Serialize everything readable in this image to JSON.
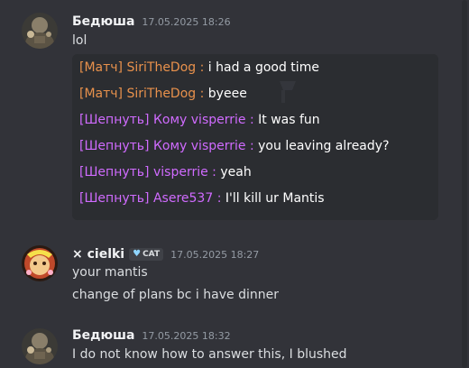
{
  "messages": [
    {
      "username": "Бедюша",
      "timestamp": "17.05.2025 18:26",
      "lines": [
        "lol"
      ],
      "embed_lines": [
        {
          "tag": "[Матч]",
          "name": "SiriTheDog",
          "sep": ":",
          "text": "i had a good time",
          "kind": "match"
        },
        {
          "tag": "[Матч]",
          "name": "SiriTheDog",
          "sep": ":",
          "text": "byeee",
          "kind": "match"
        },
        {
          "tag": "[Шепнуть]",
          "name": "Кому visperrie",
          "sep": ":",
          "text": "It was fun",
          "kind": "whisper"
        },
        {
          "tag": "[Шепнуть]",
          "name": "Кому visperrie",
          "sep": ":",
          "text": "you leaving already?",
          "kind": "whisper"
        },
        {
          "tag": "[Шепнуть]",
          "name": "visperrie",
          "sep": ":",
          "text": "yeah",
          "kind": "whisper"
        },
        {
          "tag": "[Шепнуть]",
          "name": "Asere537",
          "sep": ":",
          "text": "I'll kill ur Mantis",
          "kind": "whisper"
        }
      ]
    },
    {
      "username": "× cielki",
      "badge": "CAT",
      "badge_icon": "heart-icon",
      "timestamp": "17.05.2025 18:27",
      "lines": [
        "your mantis",
        "change of plans bc i have dinner"
      ]
    },
    {
      "username": "Бедюша",
      "timestamp": "17.05.2025 18:32",
      "lines": [
        "I do not know how to answer this, I blushed"
      ]
    }
  ],
  "colors": {
    "background": "#323339",
    "embed_background": "#2b2d31",
    "match_color": "#e8914c",
    "whisper_color": "#d06bff",
    "text_color": "#dbdee1",
    "timestamp_color": "#949ba4"
  }
}
